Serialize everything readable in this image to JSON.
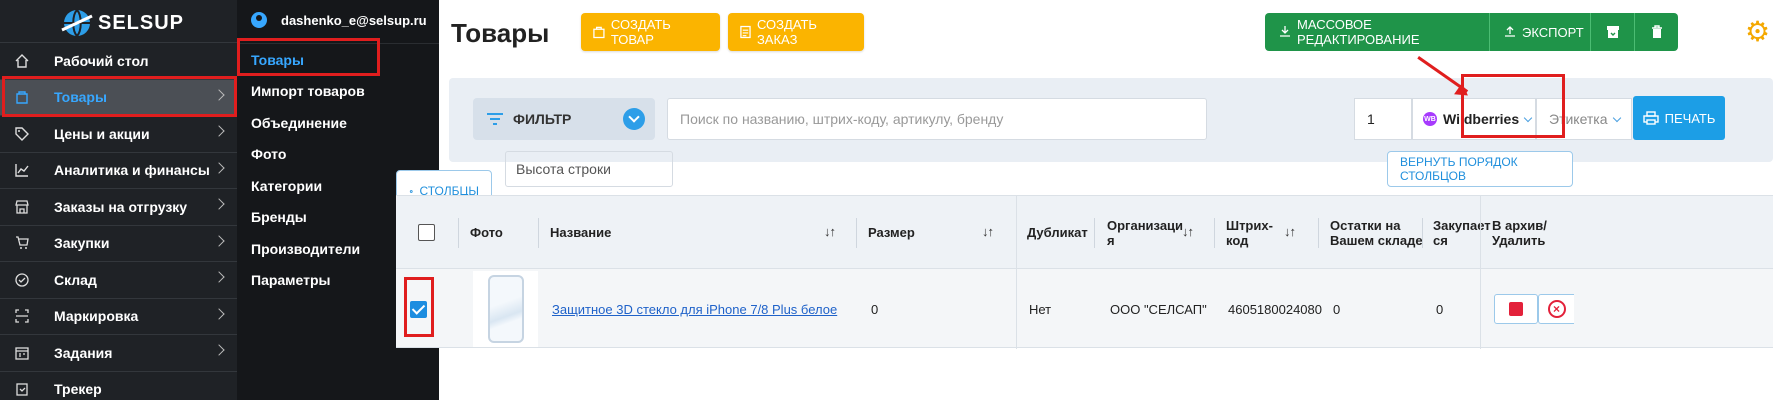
{
  "app": {
    "brand": "SELSUP"
  },
  "user": {
    "email": "dashenko_e@selsup.ru"
  },
  "sidebar": {
    "items": [
      {
        "label": "Рабочий стол",
        "icon": "home-icon",
        "chevron": false
      },
      {
        "label": "Товары",
        "icon": "box-icon",
        "chevron": true,
        "active": true
      },
      {
        "label": "Цены и акции",
        "icon": "tag-icon",
        "chevron": true
      },
      {
        "label": "Аналитика и финансы",
        "icon": "chart-line-icon",
        "chevron": true
      },
      {
        "label": "Заказы на отгрузку",
        "icon": "store-icon",
        "chevron": true
      },
      {
        "label": "Закупки",
        "icon": "cart-icon",
        "chevron": true
      },
      {
        "label": "Склад",
        "icon": "check-circle-icon",
        "chevron": true
      },
      {
        "label": "Маркировка",
        "icon": "scan-icon",
        "chevron": true
      },
      {
        "label": "Задания",
        "icon": "calendar-icon",
        "chevron": true
      },
      {
        "label": "Трекер",
        "icon": "clipboard-icon",
        "chevron": false
      }
    ]
  },
  "submenu": {
    "items": [
      {
        "label": "Товары",
        "active": true
      },
      {
        "label": "Импорт товаров"
      },
      {
        "label": "Объединение"
      },
      {
        "label": "Фото"
      },
      {
        "label": "Категории"
      },
      {
        "label": "Бренды"
      },
      {
        "label": "Производители"
      },
      {
        "label": "Параметры"
      }
    ]
  },
  "header": {
    "title": "Товары",
    "create_product": "СОЗДАТЬ ТОВАР",
    "create_order": "СОЗДАТЬ ЗАКАЗ",
    "mass_edit": "МАССОВОЕ РЕДАКТИРОВАНИЕ",
    "export": "ЭКСПОРТ"
  },
  "toolbar": {
    "filter_label": "ФИЛЬТР",
    "search_placeholder": "Поиск по названию, штрих-коду, артикулу, бренду",
    "quantity": "1",
    "marketplace": "Wildberries",
    "marketplace_logo": "WB",
    "label_type": "Этикетка",
    "print": "ПЕЧАТЬ"
  },
  "columns_bar": {
    "columns_button": "СТОЛБЦЫ",
    "row_height_placeholder": "Высота строки",
    "reset_order": "ВЕРНУТЬ ПОРЯДОК СТОЛБЦОВ"
  },
  "table": {
    "headers": {
      "photo": "Фото",
      "name": "Название",
      "size": "Размер",
      "duplicate": "Дубликат",
      "org_line1": "Организаци",
      "org_line2": "я",
      "barcode_line1": "Штрих-",
      "barcode_line2": "код",
      "stock_line1": "Остатки на",
      "stock_line2": "Вашем складе",
      "purchase_line1": "Закупает",
      "purchase_line2": "ся",
      "archive_line1": "В архив/",
      "archive_line2": "Удалить"
    },
    "rows": [
      {
        "checked": true,
        "name": "Защитное 3D стекло для iPhone 7/8 Plus белое",
        "size": "0",
        "duplicate": "Нет",
        "organization": "ООО \"СЕЛСАП\"",
        "barcode": "4605180024080",
        "stock": "0",
        "purchase": "0"
      }
    ]
  },
  "colors": {
    "accent_blue": "#1c9ee6",
    "warning_yellow": "#fbb400",
    "success_green": "#1f9449",
    "highlight_red": "#e01e1e"
  }
}
